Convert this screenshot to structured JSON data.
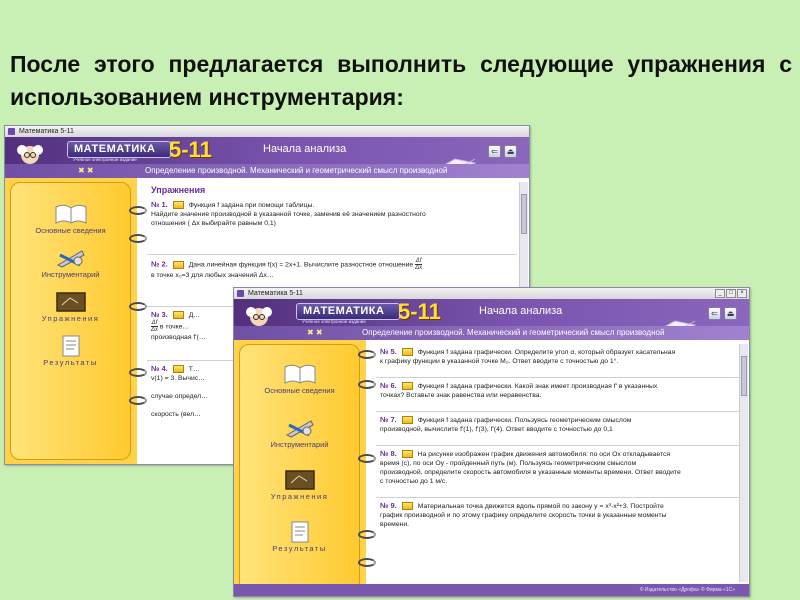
{
  "heading": "После этого предлагается выполнить следующие упражнения с использованием инструментария:",
  "app": {
    "window_title": "Математика 5-11",
    "logo_text": "МАТЕМАТИКА",
    "logo_number": "5-11",
    "logo_subtitle": "Учебное электронное издание",
    "section_title": "Начала анализа",
    "subtitle": "Определение производной. Механический и геометрический смысл производной",
    "nav_arrows": "✖ ✖",
    "sidebar": [
      {
        "label": "Основные сведения",
        "icon": "book-icon"
      },
      {
        "label": "Инструментарий",
        "icon": "tools-icon"
      },
      {
        "label": "Упражнения",
        "icon": "board-icon"
      },
      {
        "label": "Результаты",
        "icon": "results-icon"
      }
    ],
    "footer": "© Издательство «Дрофа»     © Фирма «1С»"
  },
  "window1": {
    "content_title": "Упражнения",
    "exercises": [
      {
        "num": "№ 1.",
        "text": "Функция f задана при помощи таблицы.",
        "line2": "Найдите значение производной в указанной точке, заменив её значением разностного",
        "line3": "отношения (    Δx  выбирайте равным 0,1)"
      },
      {
        "num": "№ 2.",
        "text": "Дана линейная функция f(x) = 2x+1. Вычислите разностное отношение",
        "frac_top": "Δf",
        "frac_bottom": "Δx",
        "line2": "в точке x₀=3 для любых значений Δx…"
      },
      {
        "num": "№ 3.",
        "text": "Д…",
        "frac_top": "Δf",
        "frac_bottom": "Δx",
        "line2": "в точке…",
        "line3": "производная f'(…"
      },
      {
        "num": "№ 4.",
        "text": "Т…",
        "line2": "v(1) = 3. Вычис…",
        "line3": "случае определ…",
        "line4": "скорость (вел…"
      }
    ]
  },
  "window2": {
    "exercises": [
      {
        "num": "№ 5.",
        "text": "Функция f задана графически. Определите угол α, который образует касательная",
        "line2": "к графику функции в указанной точке M₀. Ответ вводите с точностью до 1°."
      },
      {
        "num": "№ 6.",
        "text": "Функция f задана графически. Какой знак имеет производная f' в указанных",
        "line2": "точках? Вставьте знак равенства или неравенства."
      },
      {
        "num": "№ 7.",
        "text": "Функция f задана графически. Пользуясь геометрическим смыслом",
        "line2": "производной, вычислите f'(1), f'(3), f'(4). Ответ вводите с точностью до 0,1"
      },
      {
        "num": "№ 8.",
        "text": "На рисунке изображен график движения автомобиля: по оси Ox откладывается",
        "line2": "время (с), по оси Oy - пройденный путь (м). Пользуясь геометрическим смыслом",
        "line3": "производной, определите скорость автомобиля в указанные моменты времени. Ответ вводите",
        "line4": "с точностью до 1 м/с."
      },
      {
        "num": "№ 9.",
        "text": "Материальная точка движется вдоль прямой по закону y = x³-x²+3. Постройте",
        "line2": "график производной и по этому графику определите скорость точки в указанные моменты",
        "line3": "времени."
      }
    ]
  },
  "window_buttons": {
    "minimize": "_",
    "maximize": "□",
    "close": "×"
  }
}
